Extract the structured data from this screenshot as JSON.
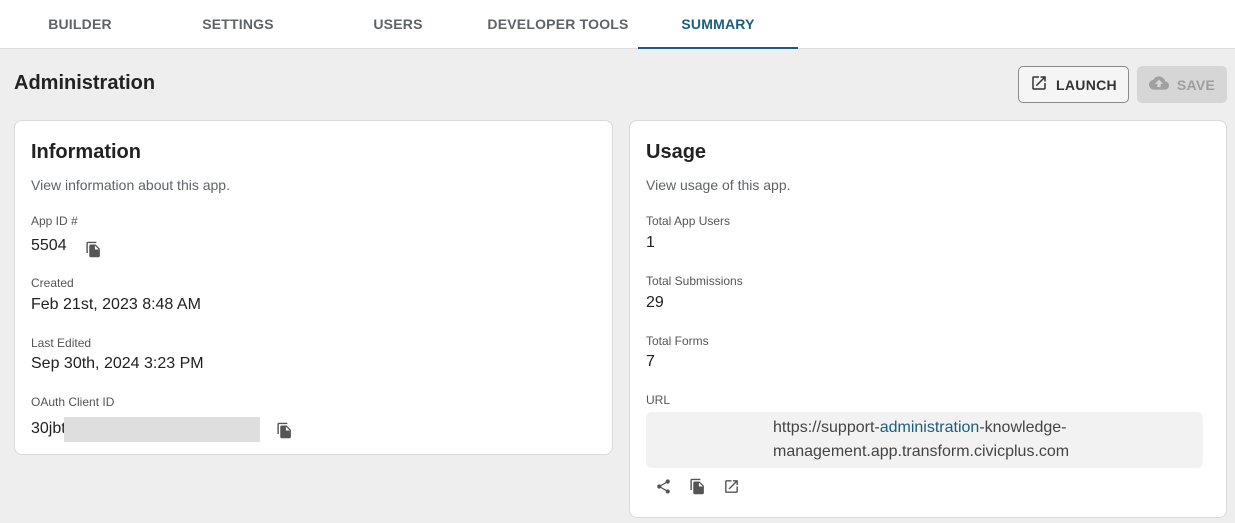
{
  "tabs": [
    {
      "label": "BUILDER",
      "active": false
    },
    {
      "label": "SETTINGS",
      "active": false
    },
    {
      "label": "USERS",
      "active": false
    },
    {
      "label": "DEVELOPER TOOLS",
      "active": false
    },
    {
      "label": "SUMMARY",
      "active": true
    }
  ],
  "page": {
    "title": "Administration"
  },
  "toolbar": {
    "launch_label": "LAUNCH",
    "launch_icon": "open-in-new-icon",
    "save_label": "SAVE",
    "save_icon": "cloud-upload-icon",
    "save_disabled": true
  },
  "information": {
    "title": "Information",
    "subtitle": "View information about this app.",
    "app_id_label": "App ID #",
    "app_id_value": "5504",
    "created_label": "Created",
    "created_value": "Feb 21st, 2023 8:48 AM",
    "last_edited_label": "Last Edited",
    "last_edited_value": "Sep 30th, 2024 3:23 PM",
    "oauth_label": "OAuth Client ID",
    "oauth_value_visible": "30jbt",
    "oauth_redacted": true
  },
  "usage": {
    "title": "Usage",
    "subtitle": "View usage of this app.",
    "total_users_label": "Total App Users",
    "total_users_value": "1",
    "total_submissions_label": "Total Submissions",
    "total_submissions_value": "29",
    "total_forms_label": "Total Forms",
    "total_forms_value": "7",
    "url_label": "URL",
    "url_prefix": "https://support-",
    "url_highlight": "administration",
    "url_suffix": "-knowledge-management.app.transform.civicplus.com",
    "url_actions": [
      "share-icon",
      "copy-icon",
      "open-in-new-icon"
    ]
  },
  "colors": {
    "accent": "#1a5e7f",
    "background": "#eeeeee",
    "card": "#ffffff",
    "disabled": "#d6d6d6"
  }
}
